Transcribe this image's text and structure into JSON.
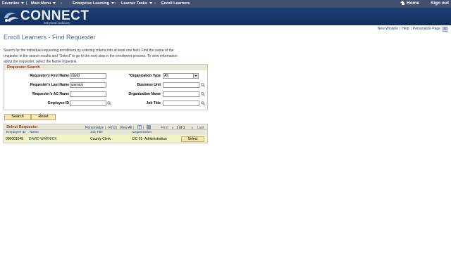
{
  "topnav": {
    "favorites": "Favorites",
    "main_menu": "Main Menu",
    "enterprise_learning": "Enterprise Learning",
    "learner_tasks": "Learner Tasks",
    "enroll_learners": "Enroll Learners",
    "home": "Home",
    "sign_out": "Sign out"
  },
  "brand": {
    "name": "CONNECT",
    "sub": "Maryland Judiciary"
  },
  "links": {
    "new_window": "New Window",
    "help": "Help",
    "personalize_page": "Personalize Page"
  },
  "page": {
    "title": "Enroll Learners - Find Requester",
    "instructions": "Search for the individual requesting enrollment by entering criteria into at least one field. Find the name of the requester in the search results and \"Select\" to go to the next step in the enrollment process. To view information about the requester, select the Name hyperlink."
  },
  "search": {
    "header": "Requester Search",
    "first_name_label": "Requester's First Name",
    "first_name_value": "david",
    "last_name_label": "Requester's Last Name",
    "last_name_value": "warnick",
    "ac_name_label": "Requester's AC Name",
    "ac_name_value": "",
    "employee_id_label": "Employee ID",
    "employee_id_value": "",
    "org_type_label": "*Organization Type",
    "org_type_value": "All",
    "business_unit_label": "Business Unit",
    "business_unit_value": "",
    "org_name_label": "Organization Name",
    "org_name_value": "",
    "job_title_label": "Job Title",
    "job_title_value": "",
    "search_button": "Search",
    "reset_button": "Reset"
  },
  "results": {
    "title": "Select Requester",
    "personalize": "Personalize",
    "find": "Find",
    "view_all": "View All",
    "first": "First",
    "range": "1 of 1",
    "last": "Last",
    "columns": [
      "Employee ID",
      "Name",
      "Job Title",
      "Organization"
    ],
    "rows": [
      {
        "employee_id": "000001048",
        "name": "DAVID WARNICK",
        "job_title": "County Clerk",
        "organization": "DC 01- Administration",
        "action": "Select"
      }
    ]
  },
  "colors": {
    "nav_bg": "#3f5070",
    "banner_bg": "#1b3e72",
    "section_header_bg": "#e8e8d9",
    "section_header_text": "#8b3a13",
    "button_bg": "#f5e7b8",
    "row_highlight": "#f2f6c5",
    "link": "#1e3b78",
    "title": "#4a6ea3"
  },
  "icons": [
    "home-icon",
    "logo-mark-icon",
    "help-icon",
    "lookup-icon",
    "dropdown-icon",
    "grid-icon",
    "download-icon"
  ]
}
